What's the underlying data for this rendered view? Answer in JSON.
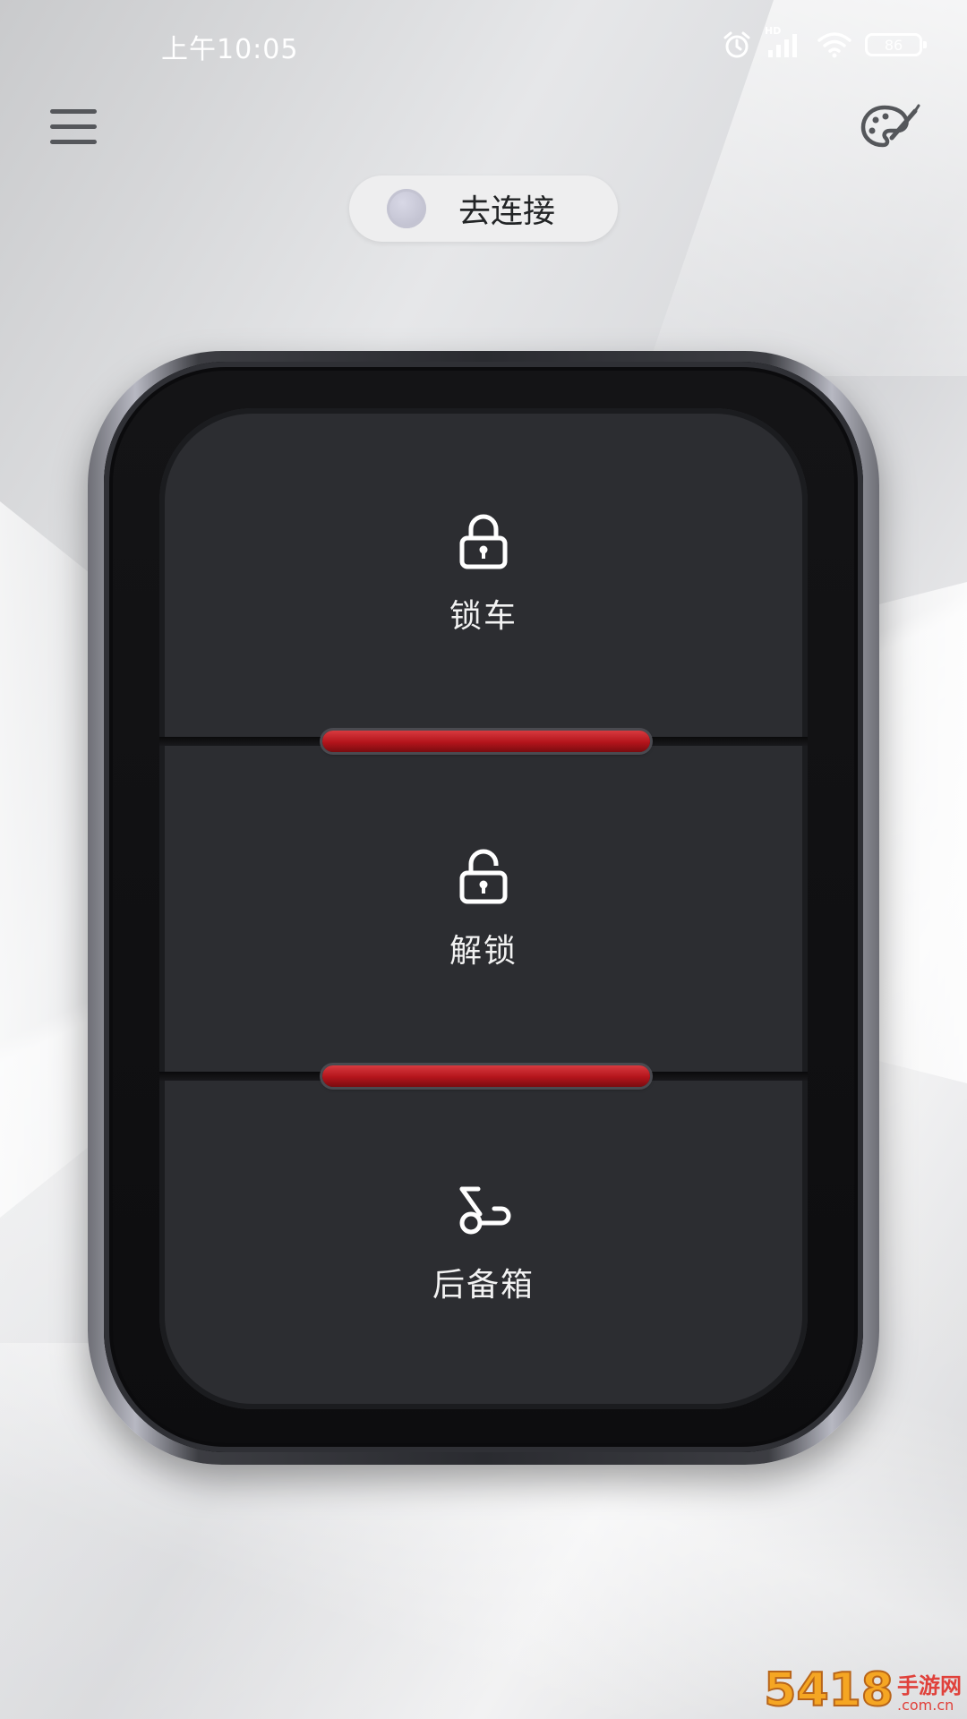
{
  "status_bar": {
    "time": "上午10:05",
    "network_label": "HD",
    "battery": "86"
  },
  "header": {
    "menu_icon": "hamburger-menu-icon",
    "theme_icon": "palette-icon"
  },
  "connect": {
    "label": "去连接",
    "status_dot_color": "#c4c4d2"
  },
  "fob": {
    "buttons": [
      {
        "label": "锁车",
        "icon": "lock-closed-icon"
      },
      {
        "label": "解锁",
        "icon": "lock-open-icon"
      },
      {
        "label": "后备箱",
        "icon": "trunk-icon"
      }
    ],
    "led_color": "#c41a21"
  },
  "watermark": {
    "number": "5418",
    "text": "手游网",
    "url": ".com.cn"
  }
}
